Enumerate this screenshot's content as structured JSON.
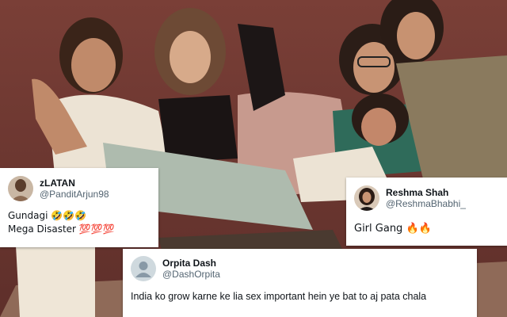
{
  "tweets": [
    {
      "display_name": "zLATAN",
      "handle": "@PanditArjun98",
      "lines": [
        "Gundagi 🤣🤣🤣",
        "Mega Disaster 💯💯💯"
      ],
      "avatar": "photo-avatar"
    },
    {
      "display_name": "Reshma Shah",
      "handle": "@ReshmaBhabhi_",
      "lines": [
        "Girl Gang 🔥🔥"
      ],
      "avatar": "photo-avatar"
    },
    {
      "display_name": "Orpita Dash",
      "handle": "@DashOrpita",
      "lines": [
        "India ko grow karne ke lia sex important hein ye bat to aj pata chala"
      ],
      "avatar": "default-person-icon"
    }
  ],
  "colors": {
    "background_wall": "#7a3f37",
    "card": "#ffffff",
    "name_text": "#0f1419",
    "handle_text": "#536471"
  }
}
